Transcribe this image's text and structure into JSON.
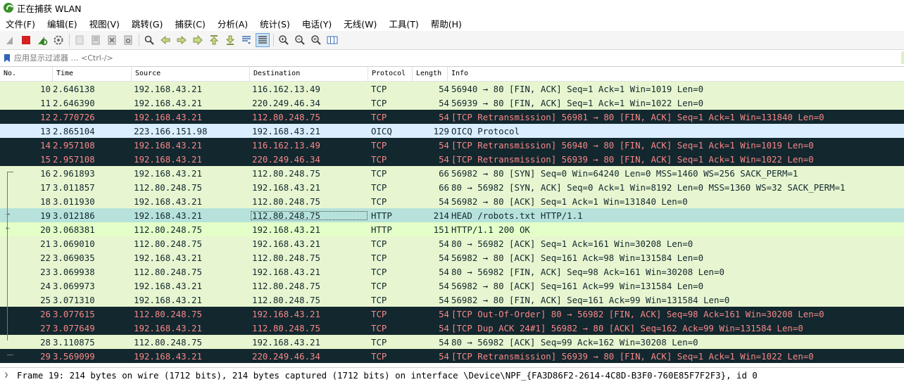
{
  "title": "正在捕获 WLAN",
  "menu": [
    "文件(F)",
    "编辑(E)",
    "视图(V)",
    "跳转(G)",
    "捕获(C)",
    "分析(A)",
    "统计(S)",
    "电话(Y)",
    "无线(W)",
    "工具(T)",
    "帮助(H)"
  ],
  "filter": {
    "placeholder": "应用显示过滤器 … <Ctrl-/>"
  },
  "columns": [
    "No.",
    "Time",
    "Source",
    "Destination",
    "Protocol",
    "Length",
    "Info"
  ],
  "packets": [
    {
      "no": "10",
      "time": "2.646138",
      "src": "192.168.43.21",
      "dst": "116.162.13.49",
      "proto": "TCP",
      "len": "54",
      "info": "56940 → 80 [FIN, ACK] Seq=1 Ack=1 Win=1019 Len=0",
      "color": "tcp"
    },
    {
      "no": "11",
      "time": "2.646390",
      "src": "192.168.43.21",
      "dst": "220.249.46.34",
      "proto": "TCP",
      "len": "54",
      "info": "56939 → 80 [FIN, ACK] Seq=1 Ack=1 Win=1022 Len=0",
      "color": "tcp"
    },
    {
      "no": "12",
      "time": "2.770726",
      "src": "192.168.43.21",
      "dst": "112.80.248.75",
      "proto": "TCP",
      "len": "54",
      "info": "[TCP Retransmission] 56981 → 80 [FIN, ACK] Seq=1 Ack=1 Win=131840 Len=0",
      "color": "bad"
    },
    {
      "no": "13",
      "time": "2.865104",
      "src": "223.166.151.98",
      "dst": "192.168.43.21",
      "proto": "OICQ",
      "len": "129",
      "info": "OICQ Protocol",
      "color": "oicq"
    },
    {
      "no": "14",
      "time": "2.957108",
      "src": "192.168.43.21",
      "dst": "116.162.13.49",
      "proto": "TCP",
      "len": "54",
      "info": "[TCP Retransmission] 56940 → 80 [FIN, ACK] Seq=1 Ack=1 Win=1019 Len=0",
      "color": "bad"
    },
    {
      "no": "15",
      "time": "2.957108",
      "src": "192.168.43.21",
      "dst": "220.249.46.34",
      "proto": "TCP",
      "len": "54",
      "info": "[TCP Retransmission] 56939 → 80 [FIN, ACK] Seq=1 Ack=1 Win=1022 Len=0",
      "color": "bad"
    },
    {
      "no": "16",
      "time": "2.961893",
      "src": "192.168.43.21",
      "dst": "112.80.248.75",
      "proto": "TCP",
      "len": "66",
      "info": "56982 → 80 [SYN] Seq=0 Win=64240 Len=0 MSS=1460 WS=256 SACK_PERM=1",
      "color": "tcp"
    },
    {
      "no": "17",
      "time": "3.011857",
      "src": "112.80.248.75",
      "dst": "192.168.43.21",
      "proto": "TCP",
      "len": "66",
      "info": "80 → 56982 [SYN, ACK] Seq=0 Ack=1 Win=8192 Len=0 MSS=1360 WS=32 SACK_PERM=1",
      "color": "tcp"
    },
    {
      "no": "18",
      "time": "3.011930",
      "src": "192.168.43.21",
      "dst": "112.80.248.75",
      "proto": "TCP",
      "len": "54",
      "info": "56982 → 80 [ACK] Seq=1 Ack=1 Win=131840 Len=0",
      "color": "tcp"
    },
    {
      "no": "19",
      "time": "3.012186",
      "src": "192.168.43.21",
      "dst": "112.80.248.75",
      "proto": "HTTP",
      "len": "214",
      "info": "HEAD /robots.txt HTTP/1.1",
      "color": "sel"
    },
    {
      "no": "20",
      "time": "3.068381",
      "src": "112.80.248.75",
      "dst": "192.168.43.21",
      "proto": "HTTP",
      "len": "151",
      "info": "HTTP/1.1 200 OK",
      "color": "http"
    },
    {
      "no": "21",
      "time": "3.069010",
      "src": "112.80.248.75",
      "dst": "192.168.43.21",
      "proto": "TCP",
      "len": "54",
      "info": "80 → 56982 [ACK] Seq=1 Ack=161 Win=30208 Len=0",
      "color": "tcp"
    },
    {
      "no": "22",
      "time": "3.069035",
      "src": "192.168.43.21",
      "dst": "112.80.248.75",
      "proto": "TCP",
      "len": "54",
      "info": "56982 → 80 [ACK] Seq=161 Ack=98 Win=131584 Len=0",
      "color": "tcp"
    },
    {
      "no": "23",
      "time": "3.069938",
      "src": "112.80.248.75",
      "dst": "192.168.43.21",
      "proto": "TCP",
      "len": "54",
      "info": "80 → 56982 [FIN, ACK] Seq=98 Ack=161 Win=30208 Len=0",
      "color": "tcp"
    },
    {
      "no": "24",
      "time": "3.069973",
      "src": "192.168.43.21",
      "dst": "112.80.248.75",
      "proto": "TCP",
      "len": "54",
      "info": "56982 → 80 [ACK] Seq=161 Ack=99 Win=131584 Len=0",
      "color": "tcp"
    },
    {
      "no": "25",
      "time": "3.071310",
      "src": "192.168.43.21",
      "dst": "112.80.248.75",
      "proto": "TCP",
      "len": "54",
      "info": "56982 → 80 [FIN, ACK] Seq=161 Ack=99 Win=131584 Len=0",
      "color": "tcp"
    },
    {
      "no": "26",
      "time": "3.077615",
      "src": "112.80.248.75",
      "dst": "192.168.43.21",
      "proto": "TCP",
      "len": "54",
      "info": "[TCP Out-Of-Order] 80 → 56982 [FIN, ACK] Seq=98 Ack=161 Win=30208 Len=0",
      "color": "bad"
    },
    {
      "no": "27",
      "time": "3.077649",
      "src": "192.168.43.21",
      "dst": "112.80.248.75",
      "proto": "TCP",
      "len": "54",
      "info": "[TCP Dup ACK 24#1] 56982 → 80 [ACK] Seq=162 Ack=99 Win=131584 Len=0",
      "color": "bad"
    },
    {
      "no": "28",
      "time": "3.110875",
      "src": "112.80.248.75",
      "dst": "192.168.43.21",
      "proto": "TCP",
      "len": "54",
      "info": "80 → 56982 [ACK] Seq=99 Ack=162 Win=30208 Len=0",
      "color": "tcp"
    },
    {
      "no": "29",
      "time": "3.569099",
      "src": "192.168.43.21",
      "dst": "220.249.46.34",
      "proto": "TCP",
      "len": "54",
      "info": "[TCP Retransmission] 56939 → 80 [FIN, ACK] Seq=1 Ack=1 Win=1022 Len=0",
      "color": "bad"
    }
  ],
  "details": {
    "expand_icon": "chevron-right-icon",
    "text": "Frame 19: 214 bytes on wire (1712 bits), 214 bytes captured (1712 bits) on interface \\Device\\NPF_{FA3D86F2-2614-4C8D-B3F0-760E85F7F2F3}, id 0"
  },
  "colors": {
    "tcp_bg": "#e7f6d0",
    "bad_bg": "#12272e",
    "bad_fg": "#f78787",
    "oicq_bg": "#daeeff",
    "selected_bg": "#b7e2dc",
    "stop_red": "#d22222"
  }
}
